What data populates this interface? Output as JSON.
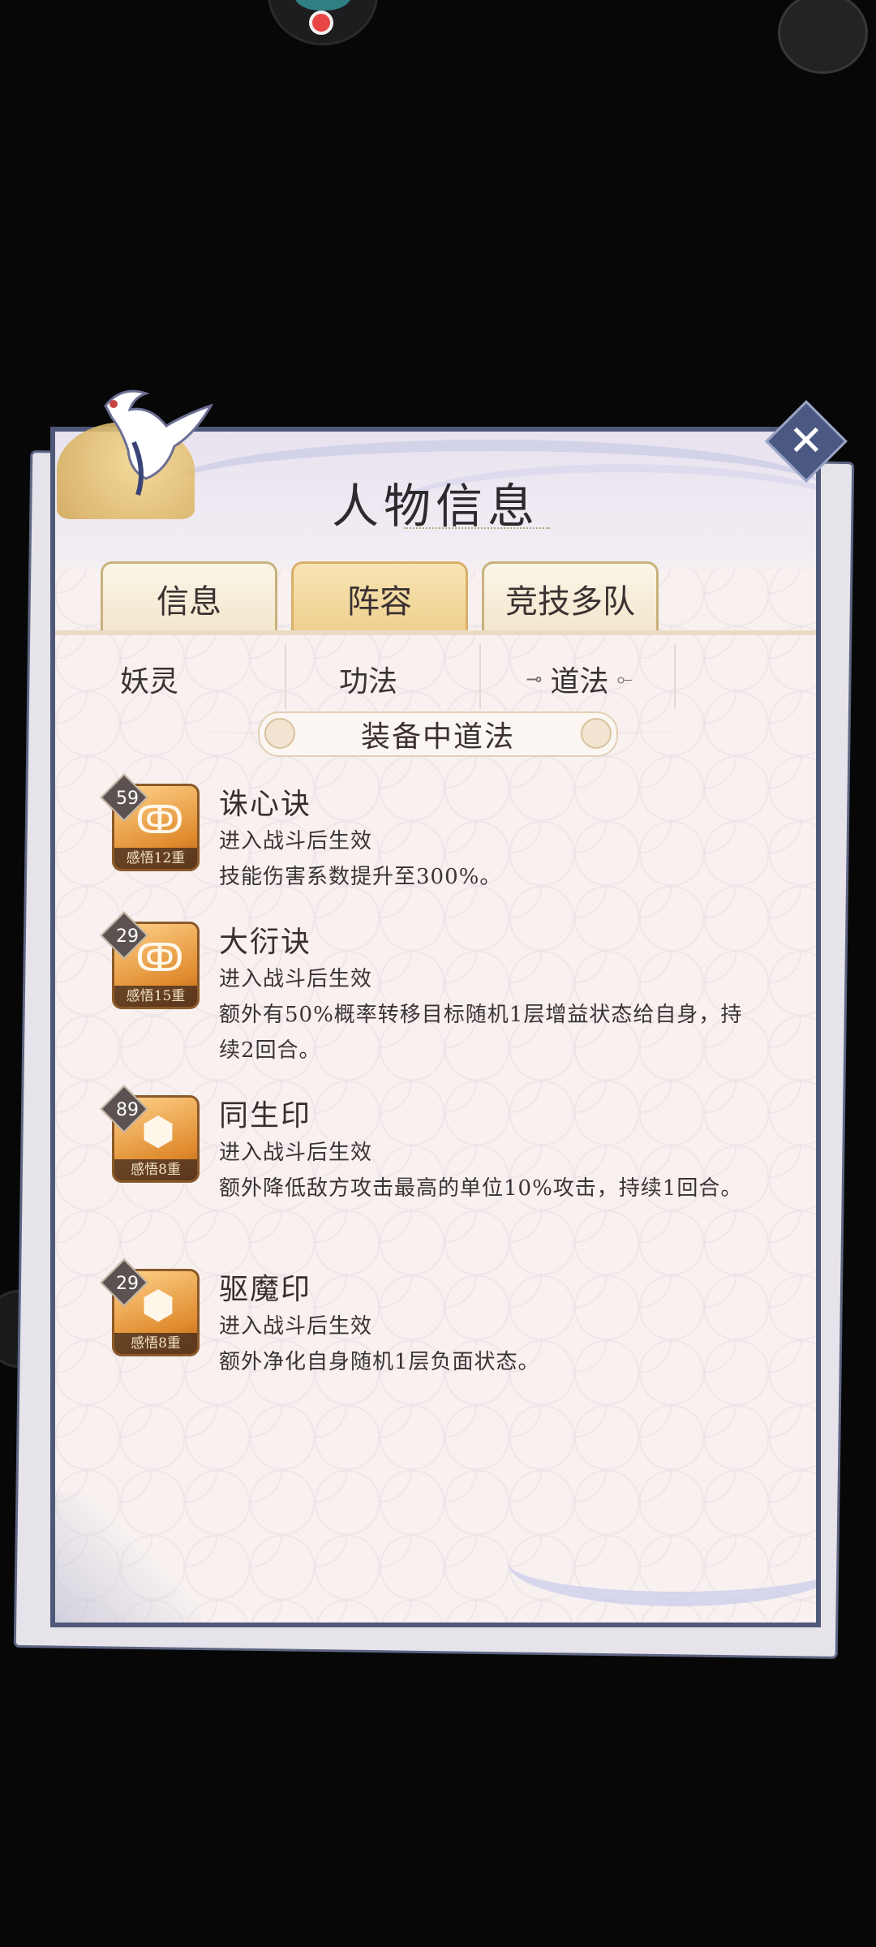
{
  "panel": {
    "title": "人物信息",
    "close_label": "✕"
  },
  "tabs": [
    {
      "label": "信息",
      "active": false
    },
    {
      "label": "阵容",
      "active": true
    },
    {
      "label": "竞技多队",
      "active": false
    }
  ],
  "subtabs": [
    {
      "label": "妖灵",
      "active": false
    },
    {
      "label": "功法",
      "active": false
    },
    {
      "label": "道法",
      "active": true
    }
  ],
  "section": {
    "title": "装备中道法"
  },
  "skills": [
    {
      "level": "59",
      "rank": "感悟12重",
      "name": "诛心诀",
      "condition": "进入战斗后生效",
      "description": "技能伤害系数提升至300%。",
      "icon": "swirl-rune-icon"
    },
    {
      "level": "29",
      "rank": "感悟15重",
      "name": "大衍诀",
      "condition": "进入战斗后生效",
      "description": "额外有50%概率转移目标随机1层增益状态给自身，持续2回合。",
      "icon": "swirl-rune-icon"
    },
    {
      "level": "89",
      "rank": "感悟8重",
      "name": "同生印",
      "condition": "进入战斗后生效",
      "description": "额外降低敌方攻击最高的单位10%攻击，持续1回合。",
      "icon": "turtle-shell-icon"
    },
    {
      "level": "29",
      "rank": "感悟8重",
      "name": "驱魔印",
      "condition": "进入战斗后生效",
      "description": "额外净化自身随机1层负面状态。",
      "icon": "turtle-shell-icon"
    }
  ]
}
